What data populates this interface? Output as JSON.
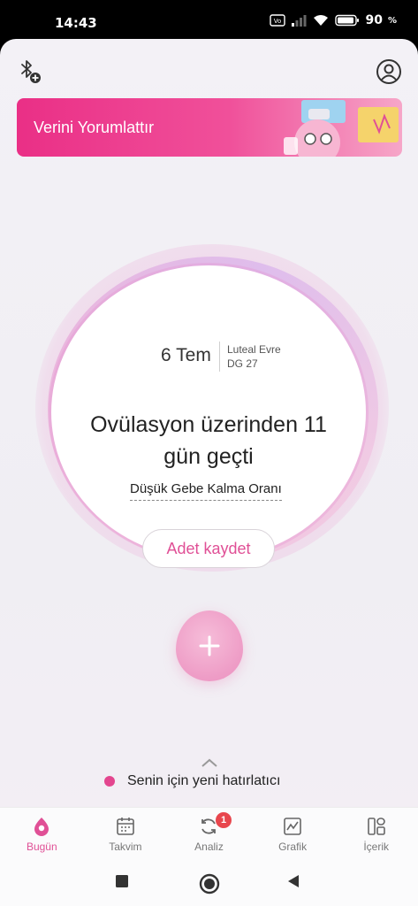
{
  "status_bar": {
    "time": "14:43",
    "battery": "90"
  },
  "banner": {
    "title": "Verini Yorumlattır"
  },
  "cycle": {
    "date": "6 Tem",
    "phase": "Luteal Evre",
    "cycle_day": "DG 27",
    "headline_line1": "Ovülasyon üzerinden 11",
    "headline_line2": "gün geçti",
    "fertility": "Düşük Gebe Kalma Oranı",
    "log_period_button": "Adet kaydet"
  },
  "reminder": {
    "text": "Senin için yeni hatırlatıcı"
  },
  "tabs": [
    {
      "label": "Bugün",
      "icon": "drop-icon",
      "active": true
    },
    {
      "label": "Takvim",
      "icon": "calendar-icon"
    },
    {
      "label": "Analiz",
      "icon": "refresh-icon",
      "badge": "1"
    },
    {
      "label": "Grafik",
      "icon": "chart-icon"
    },
    {
      "label": "İçerik",
      "icon": "grid-icon"
    }
  ],
  "colors": {
    "accent": "#e05096",
    "banner_start": "#ea2f86",
    "badge": "#e8464d"
  }
}
